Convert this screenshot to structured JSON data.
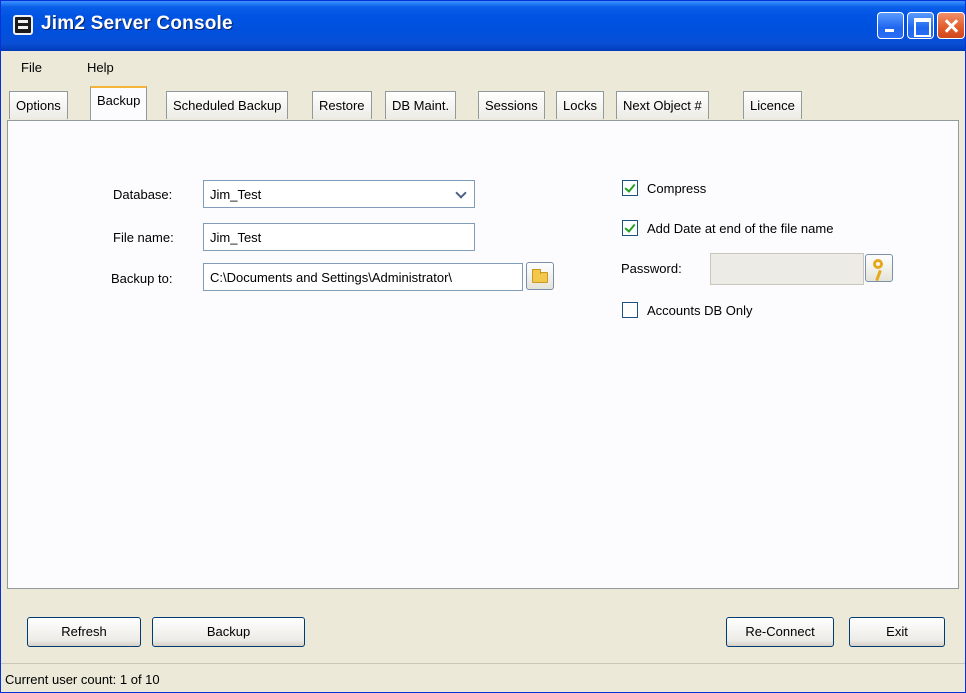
{
  "window": {
    "title": "Jim2 Server Console"
  },
  "menu": {
    "items": [
      "File",
      "Help"
    ]
  },
  "tabs": [
    "Options",
    "Backup",
    "Scheduled Backup",
    "Restore",
    "DB Maint.",
    "Sessions",
    "Locks",
    "Next Object #",
    "Licence"
  ],
  "active_tab": "Backup",
  "form": {
    "database_label": "Database:",
    "database_value": "Jim_Test",
    "filename_label": "File name:",
    "filename_value": "Jim_Test",
    "backup_to_label": "Backup to:",
    "backup_to_value": "C:\\Documents and Settings\\Administrator\\",
    "compress_label": "Compress",
    "compress_checked": true,
    "add_date_label": "Add Date at end of the file name",
    "add_date_checked": true,
    "password_label": "Password:",
    "password_value": "",
    "accounts_db_label": "Accounts DB Only",
    "accounts_db_checked": false
  },
  "buttons": {
    "refresh": "Refresh",
    "backup": "Backup",
    "reconnect": "Re-Connect",
    "exit": "Exit"
  },
  "status": {
    "text": "Current user count: 1 of 10"
  }
}
